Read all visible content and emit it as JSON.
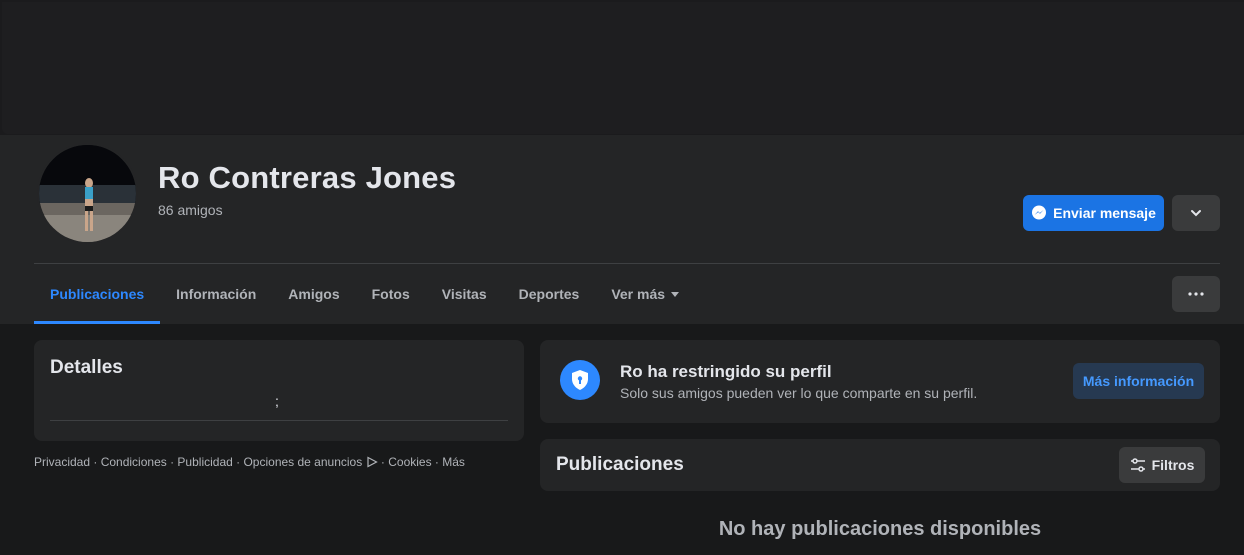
{
  "profile": {
    "name": "Ro Contreras Jones",
    "friends_count": "86 amigos"
  },
  "actions": {
    "send_message_label": "Enviar mensaje"
  },
  "tabs": [
    {
      "label": "Publicaciones",
      "active": true
    },
    {
      "label": "Información"
    },
    {
      "label": "Amigos"
    },
    {
      "label": "Fotos"
    },
    {
      "label": "Visitas"
    },
    {
      "label": "Deportes"
    },
    {
      "label": "Ver más"
    }
  ],
  "details": {
    "title": "Detalles",
    "text": ";"
  },
  "footer": {
    "privacy": "Privacidad",
    "terms": "Condiciones",
    "ads": "Publicidad",
    "ad_choices": "Opciones de anuncios",
    "cookies": "Cookies",
    "more": "Más"
  },
  "restricted": {
    "title": "Ro ha restringido su perfil",
    "subtitle": "Solo sus amigos pueden ver lo que comparte en su perfil.",
    "button": "Más información"
  },
  "posts": {
    "title": "Publicaciones",
    "filter_label": "Filtros",
    "empty_message": "No hay publicaciones disponibles"
  },
  "colors": {
    "accent": "#2d88ff",
    "button_blue": "#1b74e4",
    "surface": "#242526",
    "background": "#18191a"
  },
  "icons": {
    "messenger": "messenger-icon",
    "dropdown": "chevron-down-icon",
    "more": "ellipsis-icon",
    "shield": "shield-lock-icon",
    "filter": "sliders-icon",
    "ad_choices": "ad-choices-icon"
  }
}
